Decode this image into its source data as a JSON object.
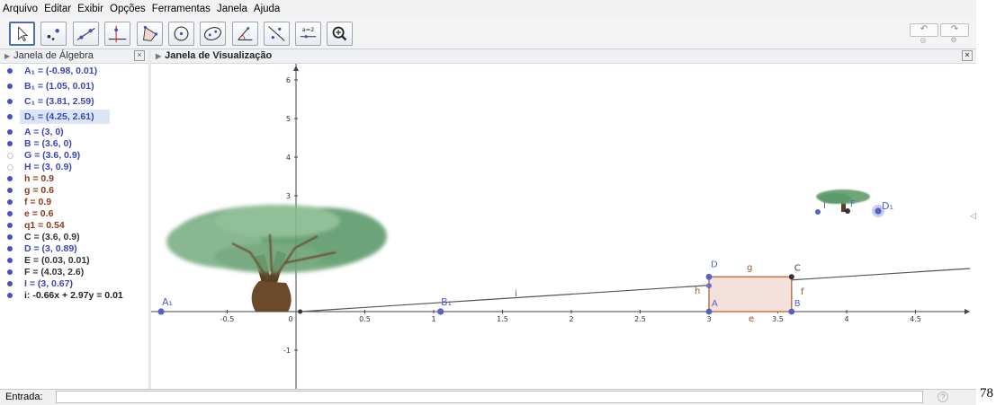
{
  "menu": [
    "Arquivo",
    "Editar",
    "Exibir",
    "Opções",
    "Ferramentas",
    "Janela",
    "Ajuda"
  ],
  "toolbar": {
    "tools": [
      "move-tool",
      "point-tool",
      "line-tool",
      "perpendicular-tool",
      "polygon-tool",
      "circle-tool",
      "conic-tool",
      "angle-tool",
      "reflect-tool",
      "slider-tool",
      "zoom-tool"
    ],
    "slider_label": "a=2",
    "undo_label": "↶",
    "redo_label": "↷"
  },
  "algebra": {
    "title": "Janela de Álgebra",
    "items": [
      {
        "text": "A₁ = (-0.98, 0.01)",
        "color": "#3a46b8",
        "hollow": false
      },
      {
        "text": "B₁ = (1.05, 0.01)",
        "color": "#3a46b8",
        "hollow": false
      },
      {
        "text": "C₁ = (3.81, 2.59)",
        "color": "#3a46b8",
        "hollow": false
      },
      {
        "text": "D₁ = (4.25, 2.61)",
        "color": "#3a46b8",
        "hollow": false
      },
      {
        "text": "A = (3, 0)",
        "color": "#3a46b8",
        "hollow": false
      },
      {
        "text": "B = (3.6, 0)",
        "color": "#3a46b8",
        "hollow": false
      },
      {
        "text": "G = (3.6, 0.9)",
        "color": "#3a46b8",
        "hollow": true
      },
      {
        "text": "H = (3, 0.9)",
        "color": "#3a46b8",
        "hollow": true
      },
      {
        "text": "h = 0.9",
        "color": "#8b3a1a",
        "hollow": false
      },
      {
        "text": "g = 0.6",
        "color": "#8b3a1a",
        "hollow": false
      },
      {
        "text": "f = 0.9",
        "color": "#8b3a1a",
        "hollow": false
      },
      {
        "text": "e = 0.6",
        "color": "#8b3a1a",
        "hollow": false
      },
      {
        "text": "q1 = 0.54",
        "color": "#8b3a1a",
        "hollow": false
      },
      {
        "text": "C = (3.6, 0.9)",
        "color": "#333333",
        "hollow": false
      },
      {
        "text": "D = (3, 0.89)",
        "color": "#3a46b8",
        "hollow": false
      },
      {
        "text": "E = (0.03, 0.01)",
        "color": "#333333",
        "hollow": false
      },
      {
        "text": "F = (4.03, 2.6)",
        "color": "#333333",
        "hollow": false
      },
      {
        "text": "I = (3, 0.67)",
        "color": "#3a46b8",
        "hollow": false
      },
      {
        "text": "i: -0.66x + 2.97y = 0.01",
        "color": "#222222",
        "hollow": false
      }
    ],
    "selected_index": 3
  },
  "view": {
    "title": "Janela de Visualização",
    "x_ticks": [
      "-0.5",
      "0",
      "0.5",
      "1",
      "1.5",
      "2",
      "2.5",
      "3",
      "3.5",
      "4",
      "4.5"
    ],
    "y_ticks": [
      "6",
      "5",
      "4",
      "3",
      "-1"
    ],
    "labels": {
      "A1": "A₁",
      "B1": "B₁",
      "D1": "D₁",
      "C1": "C",
      "A": "A",
      "B": "B",
      "C": "C",
      "D": "D",
      "g": "g",
      "h": "h",
      "f": "f",
      "e": "e",
      "i": "i",
      "I": "I",
      "F": "F"
    },
    "rect_fill": "#f5e1dc",
    "rect_stroke": "#c0744a"
  },
  "input": {
    "label": "Entrada:",
    "value": "",
    "help": "?"
  },
  "page_number": "78"
}
